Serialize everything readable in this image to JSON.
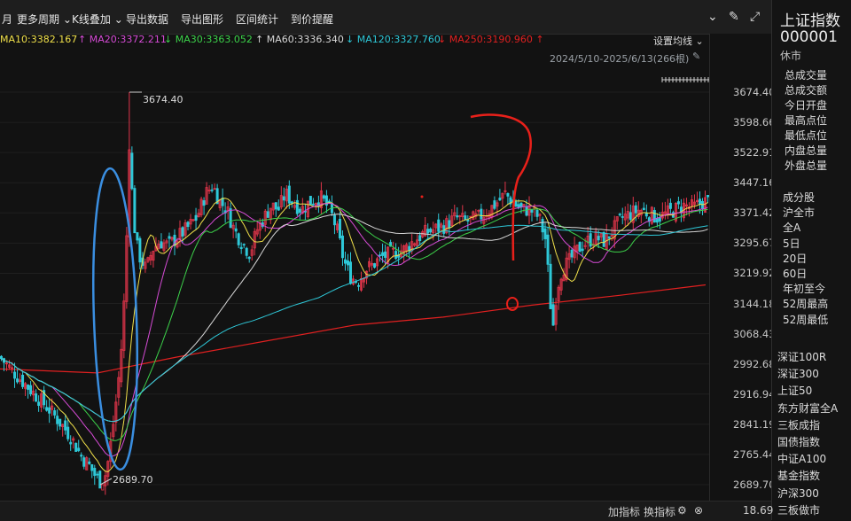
{
  "toolbar": {
    "month_label": "月",
    "more_period": "更多周期",
    "kline_overlay": "K线叠加",
    "export_data": "导出数据",
    "export_chart": "导出图形",
    "interval_stats": "区间统计",
    "price_alert": "到价提醒",
    "icons": [
      "chevron-down-circle-icon",
      "brush-icon",
      "expand-icon"
    ]
  },
  "ma_legend": [
    {
      "label": "MA10:3382.167",
      "color": "#f0e04a"
    },
    {
      "label": "↑ MA20:3372.211",
      "color": "#d64bd6"
    },
    {
      "label": "↓ MA30:3363.052",
      "color": "#3cd24a"
    },
    {
      "label": "↑ MA60:3336.340",
      "color": "#d8d8d8"
    },
    {
      "label": "↓ MA120:3327.760",
      "color": "#2ec8d8"
    },
    {
      "label": "↓ MA250:3190.960 ↑",
      "color": "#e02020"
    }
  ],
  "settings_ma": "设置均线",
  "date_range": "2024/5/10-2025/6/13(266根)",
  "chart_data": {
    "type": "candlestick",
    "y_ticks": [
      "3674.40",
      "3598.66",
      "3522.91",
      "3447.16",
      "3371.42",
      "3295.67",
      "3219.92",
      "3144.18",
      "3068.43",
      "2992.68",
      "2916.94",
      "2841.19",
      "2765.44",
      "2689.70"
    ],
    "ylim": [
      2689.7,
      3674.4
    ],
    "high_label": "3674.40",
    "low_label": "2689.70",
    "colors": {
      "up": "#e0354a",
      "down": "#2ec8d8",
      "ma10": "#f0e04a",
      "ma20": "#d64bd6",
      "ma30": "#3cd24a",
      "ma60": "#d8d8d8",
      "ma120": "#2ec8d8",
      "ma250": "#e02020",
      "annotation_oval": "#3a8ee0",
      "annotation_red": "#e8201a"
    }
  },
  "sidebar": {
    "title": "上证指数",
    "code": "000001",
    "status": "休市",
    "stats": [
      "总成交量",
      "总成交额",
      "今日开盘",
      "最高点位",
      "最低点位",
      "内盘总量",
      "外盘总量"
    ],
    "tags": [
      "成分股",
      "沪全市",
      "全A",
      "5日",
      "20日",
      "60日",
      "年初至今",
      "52周最高",
      "52周最低"
    ],
    "indices": [
      "深证100R",
      "深证300",
      "上证50",
      "东方财富全A",
      "三板成指",
      "国债指数",
      "中证A100",
      "基金指数",
      "沪深300",
      "三板做市"
    ]
  },
  "bottom": {
    "add_indicator": "加指标",
    "switch_indicator": "换指标",
    "value": "18.69"
  }
}
